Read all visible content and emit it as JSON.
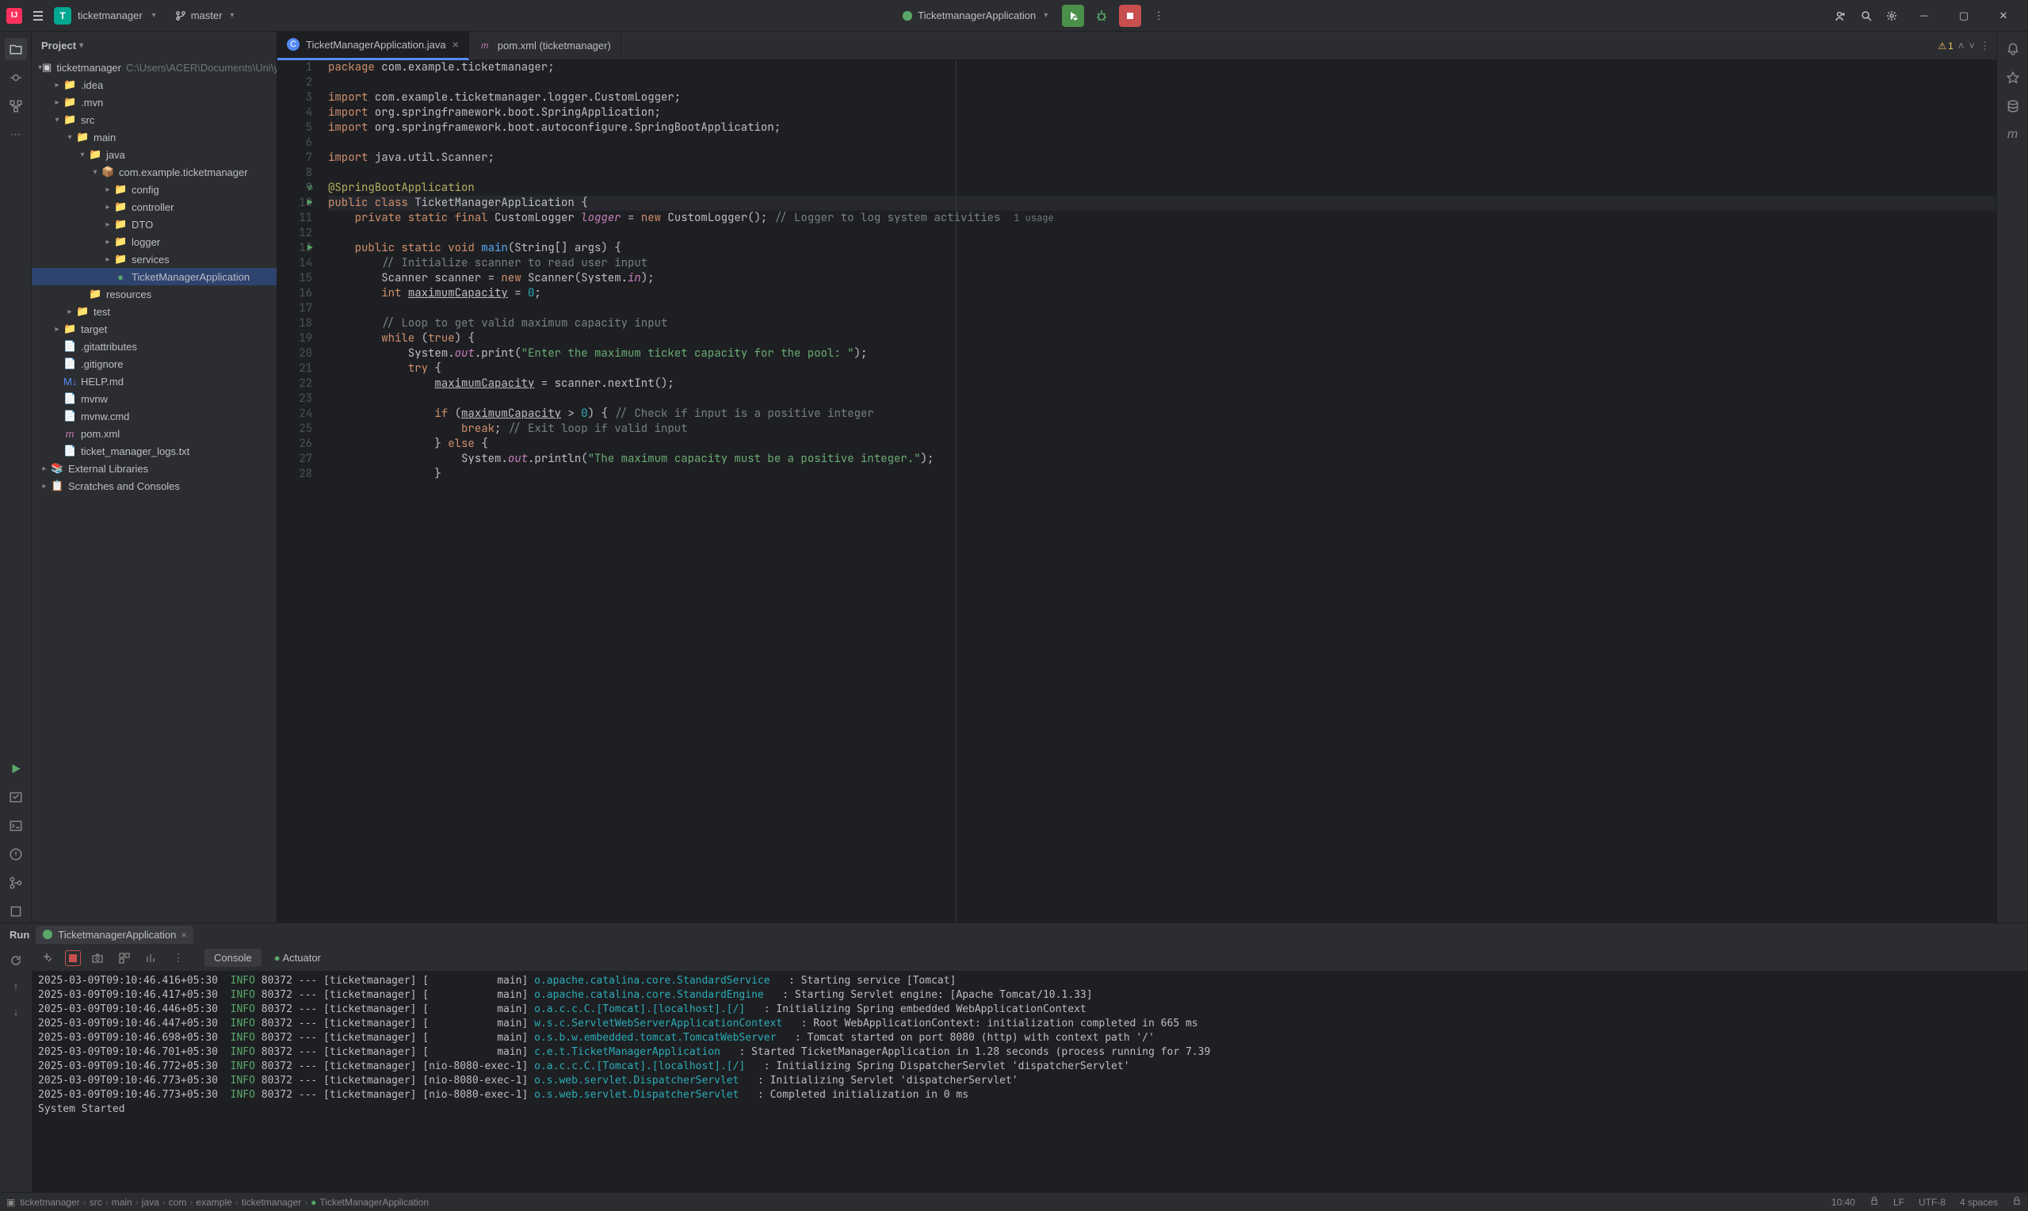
{
  "titlebar": {
    "project_letter": "T",
    "project_name": "ticketmanager",
    "branch": "master",
    "run_config": "TicketmanagerApplication"
  },
  "project_panel": {
    "header": "Project",
    "root": "ticketmanager",
    "root_hint": "C:\\Users\\ACER\\Documents\\Uni\\year...",
    "nodes": [
      ".idea",
      ".mvn",
      "src",
      "main",
      "java",
      "com.example.ticketmanager",
      "config",
      "controller",
      "DTO",
      "logger",
      "services",
      "TicketManagerApplication",
      "resources",
      "test",
      "target",
      ".gitattributes",
      ".gitignore",
      "HELP.md",
      "mvnw",
      "mvnw.cmd",
      "pom.xml",
      "ticket_manager_logs.txt",
      "External Libraries",
      "Scratches and Consoles"
    ]
  },
  "editor": {
    "tabs": [
      {
        "label": "TicketManagerApplication.java",
        "icon": "C",
        "active": true
      },
      {
        "label": "pom.xml (ticketmanager)",
        "icon": "m",
        "active": false
      }
    ],
    "warnings": "1",
    "lines": [
      {
        "n": 1,
        "html": "<span class='kw'>package</span> com.example.ticketmanager;"
      },
      {
        "n": 2,
        "html": ""
      },
      {
        "n": 3,
        "html": "<span class='kw'>import</span> com.example.ticketmanager.logger.CustomLogger;"
      },
      {
        "n": 4,
        "html": "<span class='kw'>import</span> org.springframework.boot.SpringApplication;"
      },
      {
        "n": 5,
        "html": "<span class='kw'>import</span> org.springframework.boot.autoconfigure.<span class='cls'>SpringBootApplication</span>;"
      },
      {
        "n": 6,
        "html": ""
      },
      {
        "n": 7,
        "html": "<span class='kw'>import</span> java.util.Scanner;"
      },
      {
        "n": 8,
        "html": ""
      },
      {
        "n": 9,
        "html": "<span class='ann'>@SpringBootApplication</span>",
        "block": true
      },
      {
        "n": 10,
        "html": "<span class='kw'>public class</span> TicketManagerApplication {",
        "hl": true,
        "run": true
      },
      {
        "n": 11,
        "html": "    <span class='kw'>private static final</span> CustomLogger <span class='fld'>logger</span> = <span class='kw'>new</span> CustomLogger(); <span class='com'>// Logger to log system activities</span>  <span class='usage-hint'>1 usage</span>"
      },
      {
        "n": 12,
        "html": ""
      },
      {
        "n": 13,
        "html": "    <span class='kw'>public static void</span> <span class='mth'>main</span>(String[] args) {",
        "run": true
      },
      {
        "n": 14,
        "html": "        <span class='com'>// Initialize scanner to read user input</span>"
      },
      {
        "n": 15,
        "html": "        Scanner scanner = <span class='kw'>new</span> Scanner(System.<span class='fld'>in</span>);"
      },
      {
        "n": 16,
        "html": "        <span class='kw'>int</span> <u>maximumCapacity</u> = <span class='num'>0</span>;"
      },
      {
        "n": 17,
        "html": ""
      },
      {
        "n": 18,
        "html": "        <span class='com'>// Loop to get valid maximum capacity input</span>"
      },
      {
        "n": 19,
        "html": "        <span class='kw'>while</span> (<span class='kw'>true</span>) {"
      },
      {
        "n": 20,
        "html": "            System.<span class='fld'>out</span>.print(<span class='str'>\"Enter the maximum ticket capacity for the pool: \"</span>);"
      },
      {
        "n": 21,
        "html": "            <span class='kw'>try</span> {"
      },
      {
        "n": 22,
        "html": "                <u>maximumCapacity</u> = scanner.nextInt();"
      },
      {
        "n": 23,
        "html": ""
      },
      {
        "n": 24,
        "html": "                <span class='kw'>if</span> (<u>maximumCapacity</u> &gt; <span class='num'>0</span>) { <span class='com'>// Check if input is a positive integer</span>"
      },
      {
        "n": 25,
        "html": "                    <span class='kw'>break</span>; <span class='com'>// Exit loop if valid input</span>"
      },
      {
        "n": 26,
        "html": "                } <span class='kw'>else</span> {"
      },
      {
        "n": 27,
        "html": "                    System.<span class='fld'>out</span>.println(<span class='str'>\"The maximum capacity must be a positive integer.\"</span>);"
      },
      {
        "n": 28,
        "html": "                }"
      }
    ]
  },
  "run_panel": {
    "label": "Run",
    "tab": "TicketmanagerApplication",
    "console_tab": "Console",
    "actuator_tab": "Actuator",
    "logs": [
      {
        "ts": "2025-03-09T09:10:46.416+05:30",
        "lvl": "INFO",
        "pid": "80372",
        "app": "[ticketmanager]",
        "thread": "[           main]",
        "src": "o.apache.catalina.core.StandardService",
        "msg": ": Starting service [Tomcat]"
      },
      {
        "ts": "2025-03-09T09:10:46.417+05:30",
        "lvl": "INFO",
        "pid": "80372",
        "app": "[ticketmanager]",
        "thread": "[           main]",
        "src": "o.apache.catalina.core.StandardEngine",
        "msg": ": Starting Servlet engine: [Apache Tomcat/10.1.33]"
      },
      {
        "ts": "2025-03-09T09:10:46.446+05:30",
        "lvl": "INFO",
        "pid": "80372",
        "app": "[ticketmanager]",
        "thread": "[           main]",
        "src": "o.a.c.c.C.[Tomcat].[localhost].[/]",
        "msg": ": Initializing Spring embedded WebApplicationContext"
      },
      {
        "ts": "2025-03-09T09:10:46.447+05:30",
        "lvl": "INFO",
        "pid": "80372",
        "app": "[ticketmanager]",
        "thread": "[           main]",
        "src": "w.s.c.ServletWebServerApplicationContext",
        "msg": ": Root WebApplicationContext: initialization completed in 665 ms"
      },
      {
        "ts": "2025-03-09T09:10:46.698+05:30",
        "lvl": "INFO",
        "pid": "80372",
        "app": "[ticketmanager]",
        "thread": "[           main]",
        "src": "o.s.b.w.embedded.tomcat.TomcatWebServer",
        "msg": ": Tomcat started on port 8080 (http) with context path '/'"
      },
      {
        "ts": "2025-03-09T09:10:46.701+05:30",
        "lvl": "INFO",
        "pid": "80372",
        "app": "[ticketmanager]",
        "thread": "[           main]",
        "src": "c.e.t.TicketManagerApplication",
        "msg": ": Started TicketManagerApplication in 1.28 seconds (process running for 7.39"
      },
      {
        "ts": "2025-03-09T09:10:46.772+05:30",
        "lvl": "INFO",
        "pid": "80372",
        "app": "[ticketmanager]",
        "thread": "[nio-8080-exec-1]",
        "src": "o.a.c.c.C.[Tomcat].[localhost].[/]",
        "msg": ": Initializing Spring DispatcherServlet 'dispatcherServlet'"
      },
      {
        "ts": "2025-03-09T09:10:46.773+05:30",
        "lvl": "INFO",
        "pid": "80372",
        "app": "[ticketmanager]",
        "thread": "[nio-8080-exec-1]",
        "src": "o.s.web.servlet.DispatcherServlet",
        "msg": ": Initializing Servlet 'dispatcherServlet'"
      },
      {
        "ts": "2025-03-09T09:10:46.773+05:30",
        "lvl": "INFO",
        "pid": "80372",
        "app": "[ticketmanager]",
        "thread": "[nio-8080-exec-1]",
        "src": "o.s.web.servlet.DispatcherServlet",
        "msg": ": Completed initialization in 0 ms"
      }
    ],
    "footer": "System Started"
  },
  "breadcrumb": [
    "ticketmanager",
    "src",
    "main",
    "java",
    "com",
    "example",
    "ticketmanager",
    "TicketManagerApplication"
  ],
  "status": {
    "time": "10:40",
    "line_sep": "LF",
    "encoding": "UTF-8",
    "indent": "4 spaces"
  }
}
